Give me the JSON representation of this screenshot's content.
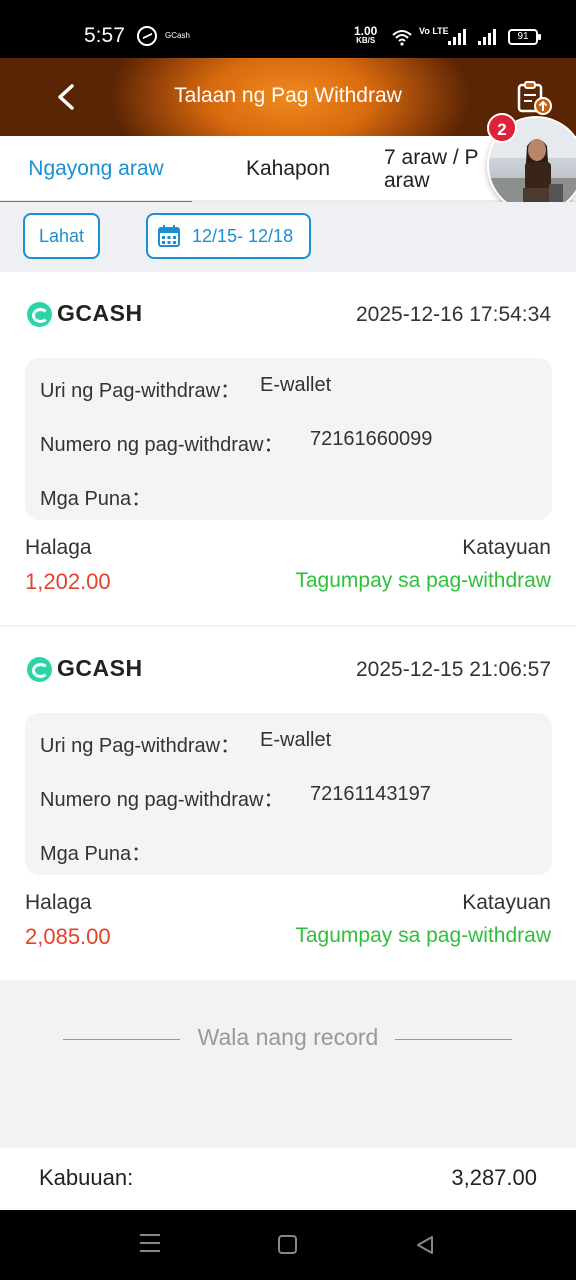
{
  "status_bar": {
    "time": "5:57",
    "app_label": "GCash",
    "net_speed": "1.00",
    "net_unit": "KB/S",
    "volte": "Vo LTE",
    "battery": "91"
  },
  "header": {
    "title": "Talaan ng Pag Withdraw"
  },
  "tabs": [
    {
      "label": "Ngayong araw"
    },
    {
      "label": "Kahapon"
    },
    {
      "label": "7 araw / P",
      "label2": "araw"
    }
  ],
  "notification_badge": "2",
  "filters": {
    "all_label": "Lahat",
    "date_range": "12/15- 12/18"
  },
  "records": [
    {
      "brand": "GCASH",
      "datetime": "2025-12-16 17:54:34",
      "type_label": "Uri ng Pag-withdraw：",
      "type_value": "E-wallet",
      "number_label": "Numero ng pag-withdraw：",
      "number_value": "72161660099",
      "remarks_label": "Mga Puna：",
      "amount_label": "Halaga",
      "amount": "1,202.00",
      "status_label": "Katayuan",
      "status": "Tagumpay sa pag-withdraw"
    },
    {
      "brand": "GCASH",
      "datetime": "2025-12-15 21:06:57",
      "type_label": "Uri ng Pag-withdraw：",
      "type_value": "E-wallet",
      "number_label": "Numero ng pag-withdraw：",
      "number_value": "72161143197",
      "remarks_label": "Mga Puna：",
      "amount_label": "Halaga",
      "amount": "2,085.00",
      "status_label": "Katayuan",
      "status": "Tagumpay sa pag-withdraw"
    }
  ],
  "end_text": "Wala nang record",
  "total": {
    "label": "Kabuuan:",
    "value": "3,287.00"
  },
  "colors": {
    "accent": "#1a8fd4",
    "amount": "#e3432a",
    "success": "#2fbf3d",
    "header_orange": "#d86a0e"
  }
}
